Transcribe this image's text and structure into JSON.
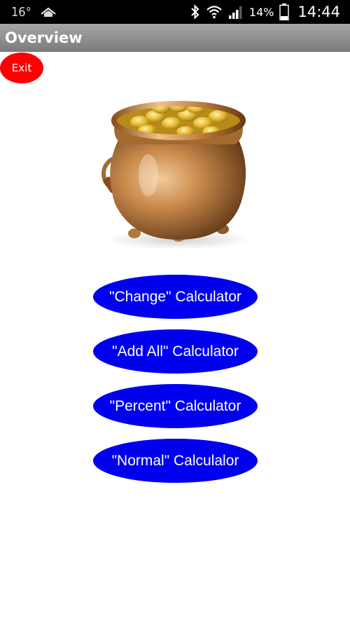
{
  "status_bar": {
    "temperature": "16°",
    "battery_percent": "14%",
    "time": "14:44",
    "icons": [
      "home-icon",
      "bluetooth-icon",
      "wifi-icon",
      "signal-icon",
      "battery-icon"
    ]
  },
  "header": {
    "title": "Overview"
  },
  "exit_button": {
    "label": "Exit",
    "color": "#ff0000"
  },
  "buttons": {
    "color": "#0000ee",
    "change": "\"Change\" Calculator",
    "add_all": "\"Add All\" Calculator",
    "percent": "\"Percent\" Calculator",
    "normal": "\"Normal\" Calculalor"
  }
}
